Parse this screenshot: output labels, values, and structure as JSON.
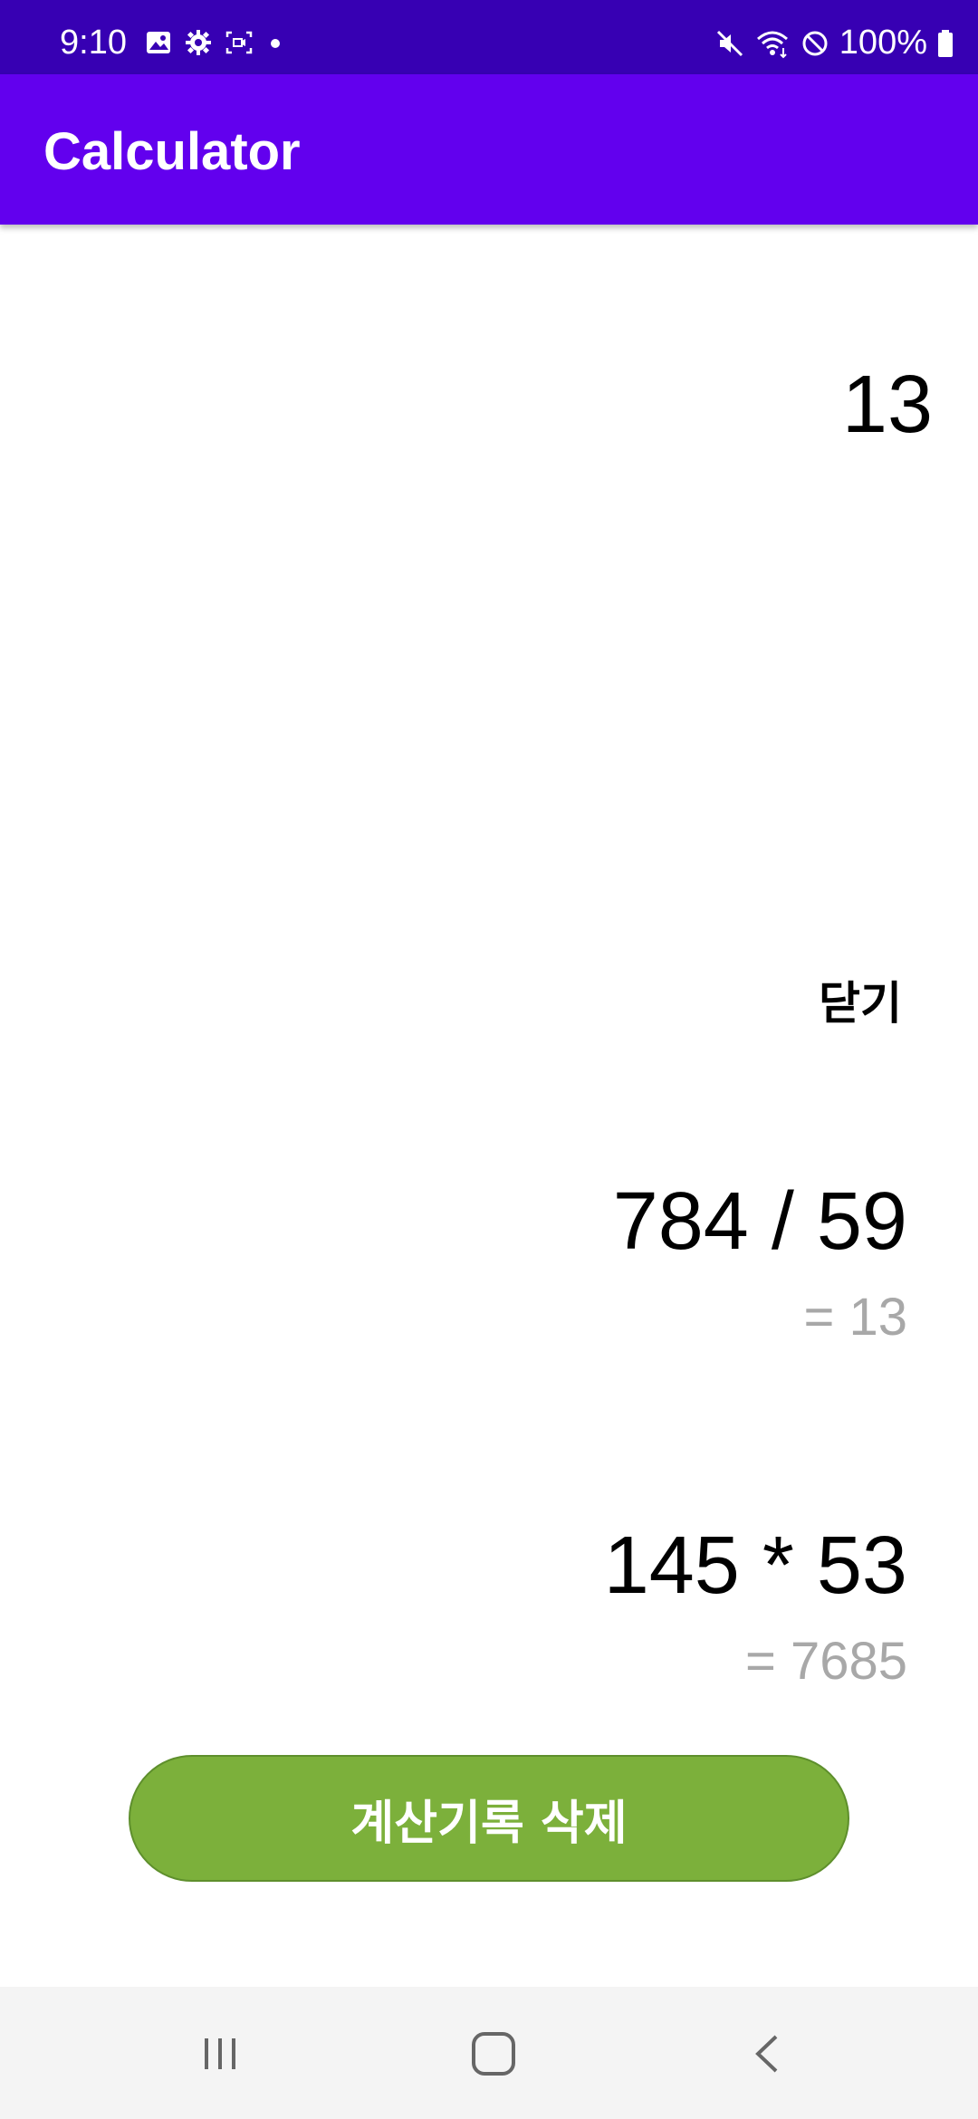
{
  "status_bar": {
    "time": "9:10",
    "battery": "100%",
    "left_icons": [
      "image-icon",
      "gear-icon",
      "screen-record-icon",
      "dot-icon"
    ],
    "right_icons": [
      "mute-icon",
      "wifi-icon",
      "block-icon",
      "battery-icon"
    ]
  },
  "app_bar": {
    "title": "Calculator"
  },
  "display": {
    "current_result": "13"
  },
  "history_panel": {
    "close_label": "닫기",
    "items": [
      {
        "expression": "784 / 59",
        "result": "= 13"
      },
      {
        "expression": "145 * 53",
        "result": "= 7685"
      }
    ],
    "clear_label": "계산기록 삭제"
  },
  "nav_bar": {
    "buttons": [
      "recent-apps-icon",
      "home-icon",
      "back-icon"
    ]
  }
}
